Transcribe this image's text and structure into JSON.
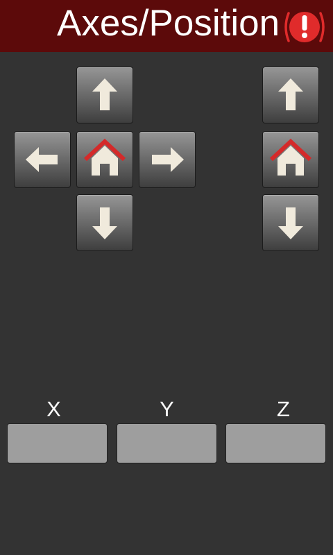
{
  "header": {
    "title": "Axes/Position",
    "alert_icon": "alert-exclamation-icon",
    "background": "#5c0a0a",
    "alert_color": "#e02b2b"
  },
  "xy_pad": {
    "up_icon": "arrow-up-icon",
    "left_icon": "arrow-left-icon",
    "home_icon": "home-icon",
    "right_icon": "arrow-right-icon",
    "down_icon": "arrow-down-icon"
  },
  "z_pad": {
    "up_icon": "arrow-up-icon",
    "home_icon": "home-icon",
    "down_icon": "arrow-down-icon"
  },
  "axes": [
    {
      "label": "X",
      "value": ""
    },
    {
      "label": "Y",
      "value": ""
    },
    {
      "label": "Z",
      "value": ""
    }
  ],
  "colors": {
    "arrow": "#f0eadc",
    "home_roof": "#d42a2a",
    "field_bg": "#9e9e9e",
    "page_bg": "#333333"
  }
}
